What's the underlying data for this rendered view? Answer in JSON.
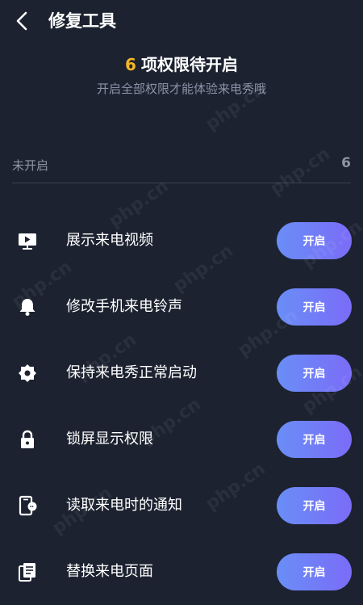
{
  "header": {
    "title": "修复工具",
    "back_icon": "chevron-left-icon"
  },
  "summary": {
    "count": "6",
    "title_text": "项权限待开启",
    "subtitle": "开启全部权限才能体验来电秀哦"
  },
  "unopened": {
    "label": "未开启",
    "count": "6"
  },
  "permissions": [
    {
      "icon": "video-presentation-icon",
      "label": "展示来电视频",
      "button": "开启"
    },
    {
      "icon": "bell-icon",
      "label": "修改手机来电铃声",
      "button": "开启"
    },
    {
      "icon": "gear-icon",
      "label": "保持来电秀正常启动",
      "button": "开启"
    },
    {
      "icon": "lock-icon",
      "label": "锁屏显示权限",
      "button": "开启"
    },
    {
      "icon": "phone-notification-icon",
      "label": "读取来电时的通知",
      "button": "开启"
    },
    {
      "icon": "copy-pages-icon",
      "label": "替换来电页面",
      "button": "开启"
    }
  ],
  "watermark": "php.cn",
  "colors": {
    "background": "#1c2230",
    "accent_count": "#f5b623",
    "button_gradient_start": "#6a8ef7",
    "button_gradient_end": "#7a6cf7"
  }
}
